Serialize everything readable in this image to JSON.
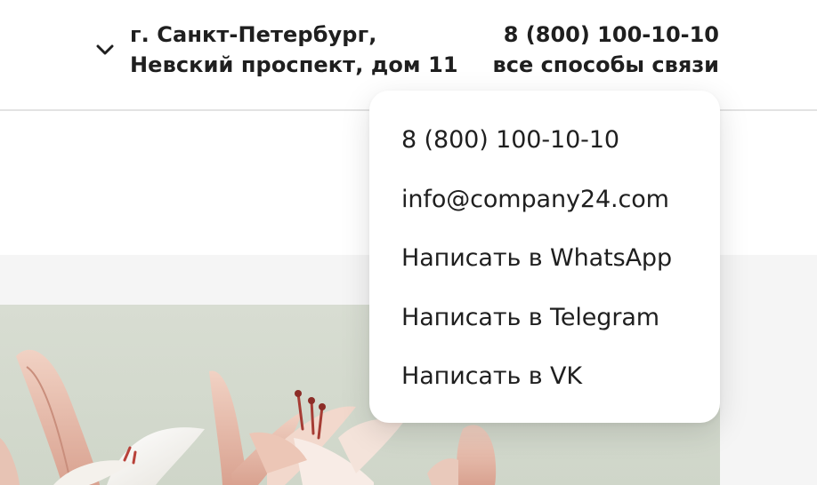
{
  "header": {
    "address_line1": "г. Санкт-Петербург,",
    "address_line2": "Невский проспект, дом 11",
    "phone": "8 (800) 100-10-10",
    "contacts_link": "все способы связи"
  },
  "dropdown": {
    "items": [
      "8 (800) 100-10-10",
      "info@company24.com",
      "Написать в WhatsApp",
      "Написать в Telegram",
      "Написать в VK"
    ]
  },
  "colors": {
    "text": "#1f1f1f",
    "divider": "#e3e3e3",
    "band": "#f5f5f5",
    "hero_bg": "#d3d9cd"
  },
  "icons": {
    "address_toggle": "chevron-down-icon"
  }
}
